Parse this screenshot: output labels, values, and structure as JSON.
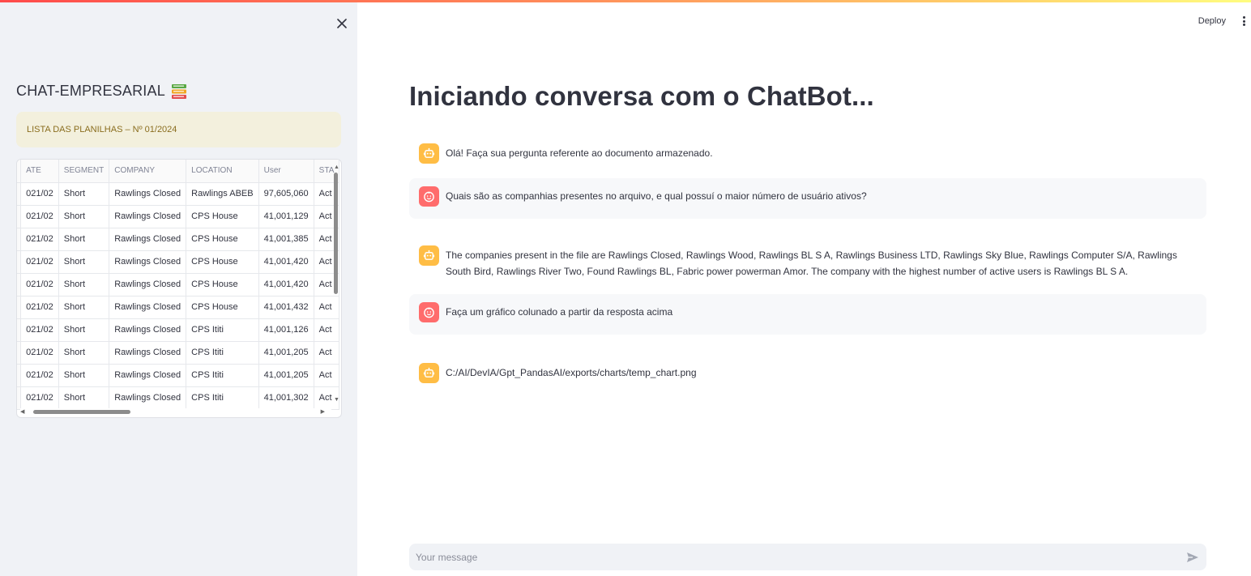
{
  "app": {
    "deploy_label": "Deploy",
    "menu_icon": "kebab-menu-icon"
  },
  "sidebar": {
    "close_icon": "close-icon",
    "title": "CHAT-EMPRESARIAL",
    "title_icon": "books-icon",
    "info_text": "LISTA DAS PLANILHAS – Nº 01/2024",
    "table": {
      "columns": [
        "ATE",
        "SEGMENT",
        "COMPANY",
        "LOCATION",
        "User",
        "STA"
      ],
      "rows": [
        {
          "idx": "0",
          "date": "021/02",
          "segment": "Short",
          "company": "Rawlings Closed",
          "location": "Rawlings ABEB",
          "user": "97,605,060",
          "status": "Act"
        },
        {
          "idx": "1",
          "date": "021/02",
          "segment": "Short",
          "company": "Rawlings Closed",
          "location": "CPS House",
          "user": "41,001,129",
          "status": "Act"
        },
        {
          "idx": "2",
          "date": "021/02",
          "segment": "Short",
          "company": "Rawlings Closed",
          "location": "CPS House",
          "user": "41,001,385",
          "status": "Act"
        },
        {
          "idx": "3",
          "date": "021/02",
          "segment": "Short",
          "company": "Rawlings Closed",
          "location": "CPS House",
          "user": "41,001,420",
          "status": "Act"
        },
        {
          "idx": "4",
          "date": "021/02",
          "segment": "Short",
          "company": "Rawlings Closed",
          "location": "CPS House",
          "user": "41,001,420",
          "status": "Act"
        },
        {
          "idx": "5",
          "date": "021/02",
          "segment": "Short",
          "company": "Rawlings Closed",
          "location": "CPS House",
          "user": "41,001,432",
          "status": "Act"
        },
        {
          "idx": "6",
          "date": "021/02",
          "segment": "Short",
          "company": "Rawlings Closed",
          "location": "CPS Ititi",
          "user": "41,001,126",
          "status": "Act"
        },
        {
          "idx": "7",
          "date": "021/02",
          "segment": "Short",
          "company": "Rawlings Closed",
          "location": "CPS Ititi",
          "user": "41,001,205",
          "status": "Act"
        },
        {
          "idx": "8",
          "date": "021/02",
          "segment": "Short",
          "company": "Rawlings Closed",
          "location": "CPS Ititi",
          "user": "41,001,205",
          "status": "Act"
        },
        {
          "idx": "9",
          "date": "021/02",
          "segment": "Short",
          "company": "Rawlings Closed",
          "location": "CPS Ititi",
          "user": "41,001,302",
          "status": "Act"
        }
      ]
    }
  },
  "main": {
    "title": "Iniciando conversa com o ChatBot...",
    "messages": [
      {
        "role": "assistant",
        "avatar_icon": "robot-icon",
        "text": "Olá! Faça sua pergunta referente ao documento armazenado."
      },
      {
        "role": "user",
        "avatar_icon": "smile-face-icon",
        "text": "Quais são as companhias presentes no arquivo, e qual possuí o maior número de usuário ativos?"
      },
      {
        "role": "assistant",
        "avatar_icon": "robot-icon",
        "text": "The companies present in the file are Rawlings Closed, Rawlings Wood, Rawlings BL S A, Rawlings Business LTD, Rawlings Sky Blue, Rawlings Computer S/A, Rawlings South Bird, Rawlings River Two, Found Rawlings BL, Fabric power powerman Amor. The company with the highest number of active users is Rawlings BL S A."
      },
      {
        "role": "user",
        "avatar_icon": "smile-face-icon",
        "text": "Faça um gráfico colunado a partir da resposta acima"
      },
      {
        "role": "assistant",
        "avatar_icon": "robot-icon",
        "text": "C:/AI/DevIA/Gpt_PandasAI/exports/charts/temp_chart.png"
      }
    ],
    "input": {
      "placeholder": "Your message",
      "value": "",
      "send_icon": "send-icon"
    }
  },
  "colors": {
    "accent": "#ff4b4b",
    "sidebar_bg": "#f0f2f6",
    "bot_avatar": "#ffbd45",
    "user_avatar": "#ff6c6c",
    "info_bg": "#f3f0dd",
    "info_text": "#8a6d1e"
  }
}
